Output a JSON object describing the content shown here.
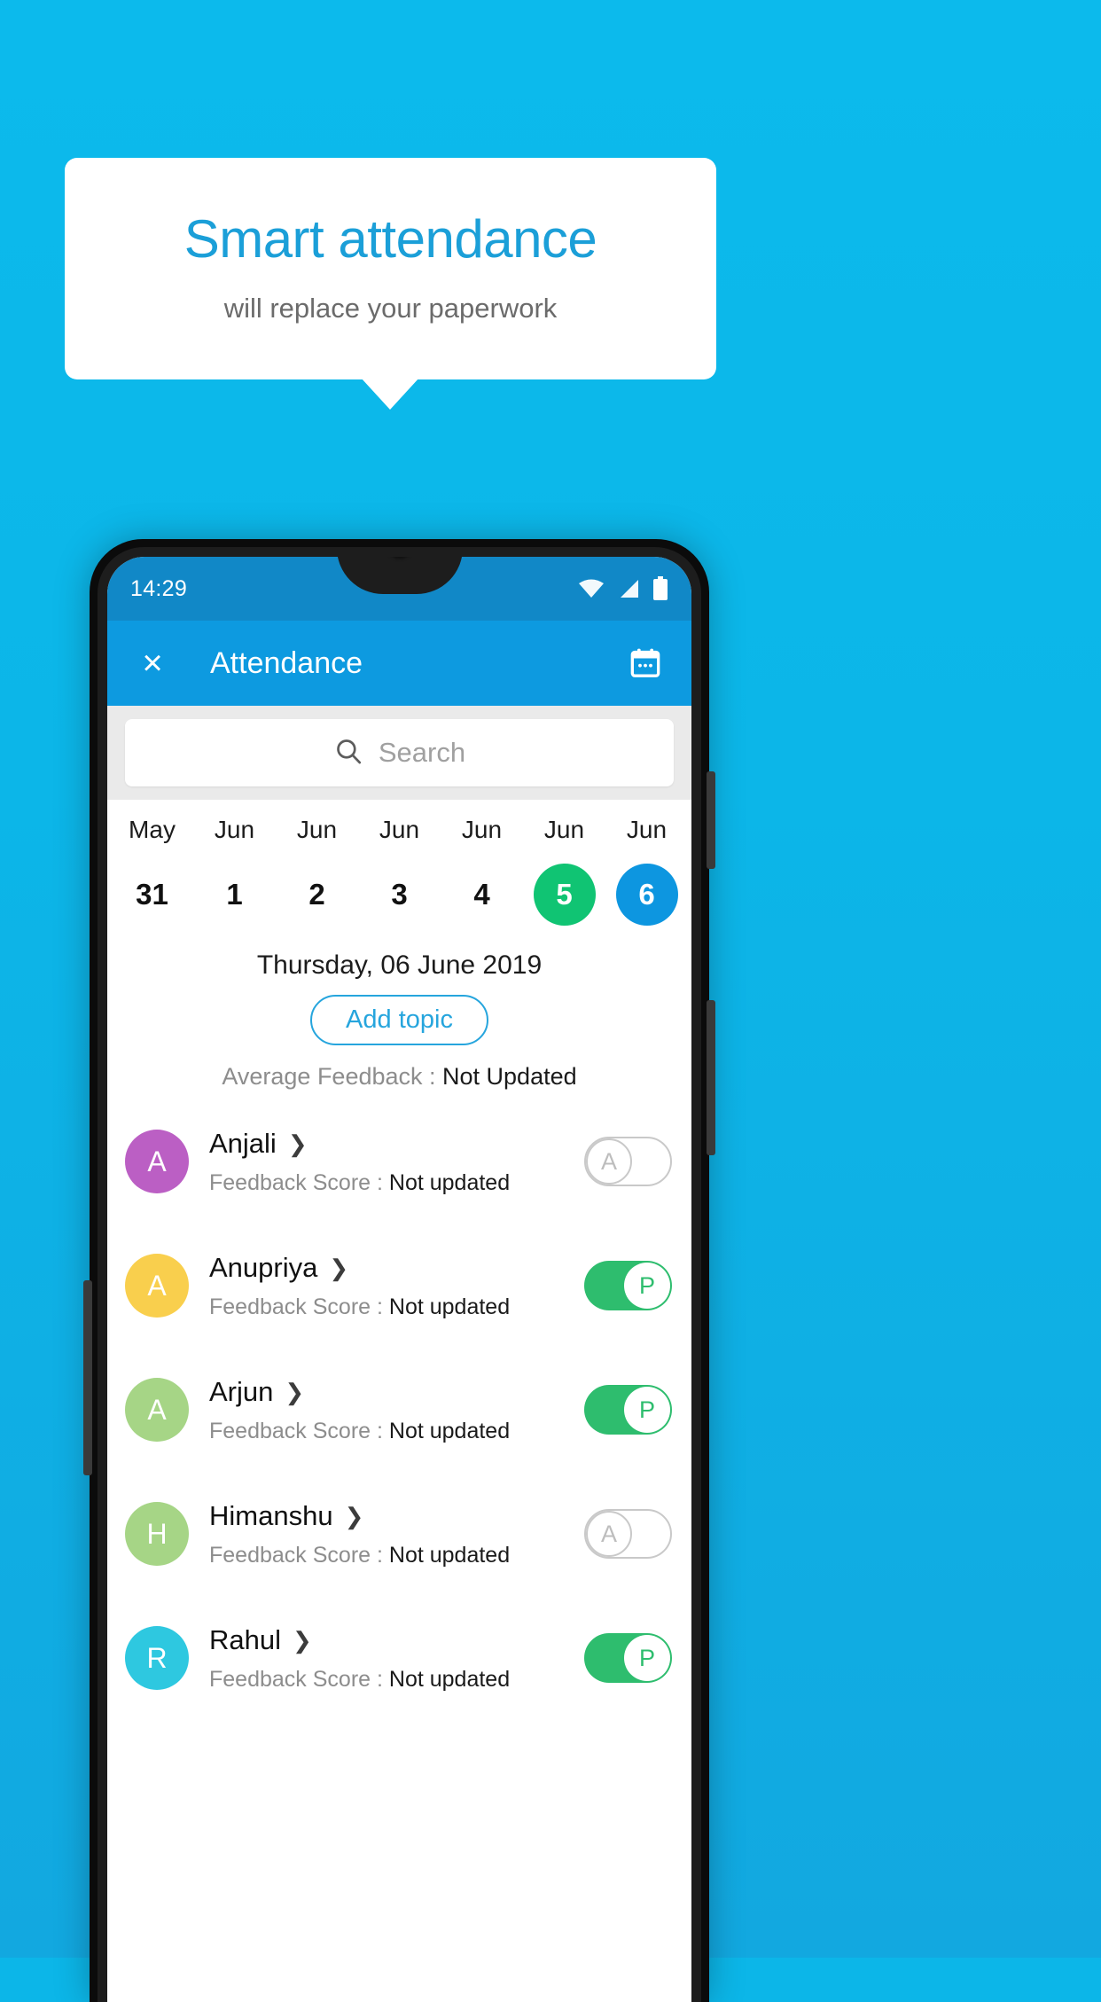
{
  "promo": {
    "title": "Smart attendance",
    "subtitle": "will replace your paperwork",
    "title_color": "#1b9fd8",
    "background_color": "#0cb6e8"
  },
  "phone": {
    "statusbar": {
      "time": "14:29",
      "icons": [
        "wifi-icon",
        "cellular-signal-icon",
        "battery-icon"
      ]
    },
    "appbar": {
      "close_label": "×",
      "title": "Attendance",
      "calendar_icon": "calendar-icon",
      "background_color": "#0d9ae0"
    },
    "search": {
      "placeholder": "Search",
      "icon": "search-icon"
    },
    "date_strip": [
      {
        "month": "May",
        "day": "31",
        "state": "normal"
      },
      {
        "month": "Jun",
        "day": "1",
        "state": "normal"
      },
      {
        "month": "Jun",
        "day": "2",
        "state": "normal"
      },
      {
        "month": "Jun",
        "day": "3",
        "state": "normal"
      },
      {
        "month": "Jun",
        "day": "4",
        "state": "normal"
      },
      {
        "month": "Jun",
        "day": "5",
        "state": "green"
      },
      {
        "month": "Jun",
        "day": "6",
        "state": "blue"
      }
    ],
    "selected_day_label": "Thursday, 06 June 2019",
    "add_topic_label": "Add topic",
    "average_feedback": {
      "label": "Average Feedback : ",
      "value": "Not Updated"
    },
    "feedback_score_label": "Feedback Score : ",
    "students": [
      {
        "name": "Anjali",
        "initial": "A",
        "avatar_color": "#bb5fc4",
        "score_value": "Not updated",
        "attendance": "A",
        "present": false
      },
      {
        "name": "Anupriya",
        "initial": "A",
        "avatar_color": "#f9cf4d",
        "score_value": "Not updated",
        "attendance": "P",
        "present": true
      },
      {
        "name": "Arjun",
        "initial": "A",
        "avatar_color": "#a6d586",
        "score_value": "Not updated",
        "attendance": "P",
        "present": true
      },
      {
        "name": "Himanshu",
        "initial": "H",
        "avatar_color": "#a6d586",
        "score_value": "Not updated",
        "attendance": "A",
        "present": false
      },
      {
        "name": "Rahul",
        "initial": "R",
        "avatar_color": "#2ec8e0",
        "score_value": "Not updated",
        "attendance": "P",
        "present": true
      }
    ]
  }
}
